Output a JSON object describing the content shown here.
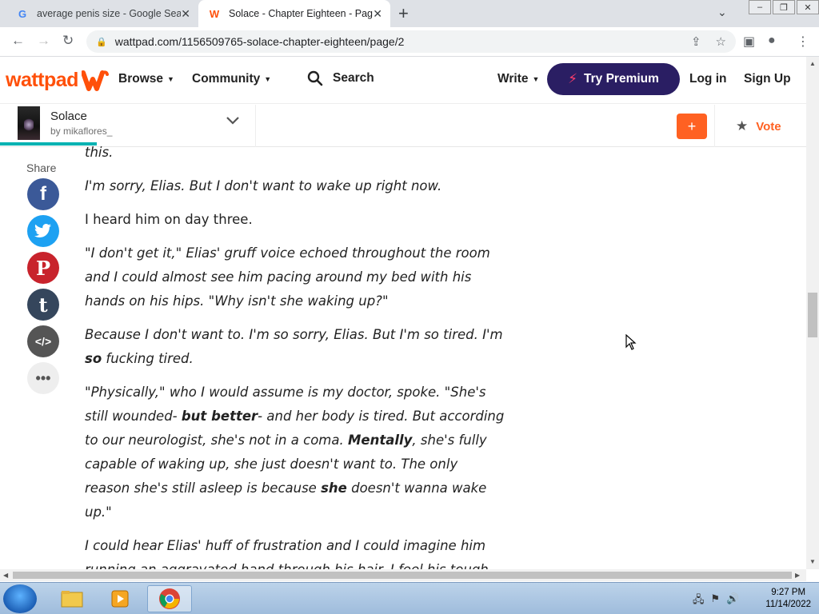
{
  "browser": {
    "tabs": [
      {
        "title": "average penis size - Google Sear",
        "active": false,
        "favicon": "google-icon"
      },
      {
        "title": "Solace - Chapter Eighteen - Page",
        "active": true,
        "favicon": "wattpad-icon"
      }
    ],
    "url": "wattpad.com/1156509765-solace-chapter-eighteen/page/2"
  },
  "header": {
    "logo_text": "wattpad",
    "browse": "Browse",
    "community": "Community",
    "search": "Search",
    "write": "Write",
    "premium": "Try Premium",
    "login": "Log in",
    "signup": "Sign Up",
    "brand_color": "#ff500a",
    "premium_color": "#2a1e63"
  },
  "story": {
    "title": "Solace",
    "author": "by mikaflores_",
    "add_label": "+",
    "vote_label": "Vote",
    "progress_fraction": 0.12
  },
  "share": {
    "label": "Share",
    "buttons": [
      "facebook-icon",
      "twitter-icon",
      "pinterest-icon",
      "tumblr-icon",
      "embed-icon",
      "more-icon"
    ]
  },
  "content": {
    "p0": "this.",
    "p1": "I'm sorry, Elias. But I don't want to wake up right now.",
    "p2": "I heard him on day three.",
    "p3_open": "\"",
    "p3": "I don't get it,\" Elias' gruff voice echoed throughout the room and I could almost see him pacing around my bed with his hands on his hips. \"Why isn't she waking up?\"",
    "p4_a": "Because I don't want to. I'm so sorry, Elias. But I'm so tired. I'm ",
    "p4_b": "so",
    "p4_c": " fucking tired.",
    "p5_a": "\"Physically,\" who I would assume is my doctor, spoke. \"She's still wounded- ",
    "p5_b": "but better",
    "p5_c": "- and her body is tired. But according to our neurologist, she's not in a coma. ",
    "p5_d": "Mentally",
    "p5_e": ", she's fully capable of waking up, she just doesn't want to. The only reason she's still asleep is because ",
    "p5_f": "she",
    "p5_g": " doesn't wanna wake up.\"",
    "p6": "I could hear Elias' huff of frustration and I could imagine him running an aggravated hand through his hair. I feel his tough hands clutch my right one suddenly in an iron tight grip and my heart squeezes."
  },
  "taskbar": {
    "time": "9:27 PM",
    "date": "11/14/2022"
  }
}
